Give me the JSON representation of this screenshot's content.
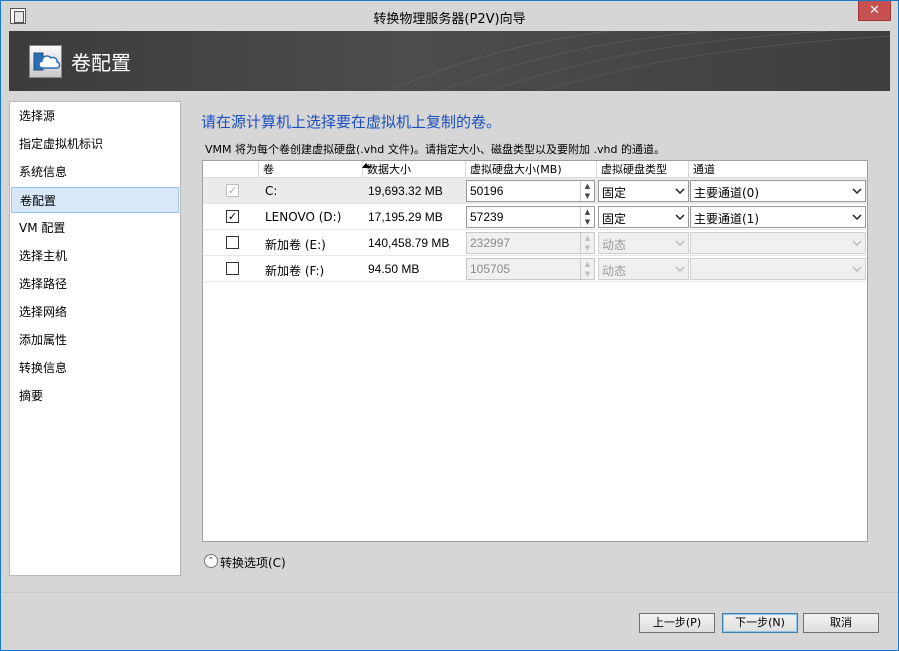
{
  "window": {
    "title": "转换物理服务器(P2V)向导",
    "close_glyph": "✕"
  },
  "header": {
    "title": "卷配置",
    "icon": "cloud-server-icon"
  },
  "nav": {
    "items": [
      {
        "label": "选择源",
        "active": false
      },
      {
        "label": "指定虚拟机标识",
        "active": false
      },
      {
        "label": "系统信息",
        "active": false
      },
      {
        "label": "卷配置",
        "active": true
      },
      {
        "label": "VM 配置",
        "active": false
      },
      {
        "label": "选择主机",
        "active": false
      },
      {
        "label": "选择路径",
        "active": false
      },
      {
        "label": "选择网络",
        "active": false
      },
      {
        "label": "添加属性",
        "active": false
      },
      {
        "label": "转换信息",
        "active": false
      },
      {
        "label": "摘要",
        "active": false
      }
    ]
  },
  "main": {
    "heading": "请在源计算机上选择要在虚拟机上复制的卷。",
    "description": "VMM 将为每个卷创建虚拟硬盘(.vhd 文件)。请指定大小、磁盘类型以及要附加 .vhd 的通道。"
  },
  "grid": {
    "columns": [
      "卷",
      "数据大小",
      "虚拟硬盘大小(MB)",
      "虚拟硬盘类型",
      "通道"
    ],
    "rows": [
      {
        "checked": true,
        "check_disabled": true,
        "volume": "C:",
        "data_size": "19,693.32 MB",
        "vhd_size": "50196",
        "vhd_type": "固定",
        "channel": "主要通道(0)",
        "enabled": true,
        "selected": true
      },
      {
        "checked": true,
        "check_disabled": false,
        "volume": "LENOVO (D:)",
        "data_size": "17,195.29 MB",
        "vhd_size": "57239",
        "vhd_type": "固定",
        "channel": "主要通道(1)",
        "enabled": true,
        "selected": false
      },
      {
        "checked": false,
        "check_disabled": false,
        "volume": "新加卷 (E:)",
        "data_size": "140,458.79 MB",
        "vhd_size": "232997",
        "vhd_type": "动态",
        "channel": "",
        "enabled": false,
        "selected": false
      },
      {
        "checked": false,
        "check_disabled": false,
        "volume": "新加卷 (F:)",
        "data_size": "94.50 MB",
        "vhd_size": "105705",
        "vhd_type": "动态",
        "channel": "",
        "enabled": false,
        "selected": false
      }
    ]
  },
  "expander": {
    "label": "转换选项(C)",
    "icon_glyph": "⌃"
  },
  "buttons": {
    "back": "上一步(P)",
    "next": "下一步(N)",
    "cancel": "取消"
  },
  "glyphs": {
    "check": "✓",
    "spin_up": "▲",
    "spin_down": "▼"
  },
  "colors": {
    "accent_heading": "#1b4fbf",
    "nav_active_bg": "#d9e8f8",
    "close_button": "#c75050",
    "header_bg": "#4a4a4a"
  }
}
